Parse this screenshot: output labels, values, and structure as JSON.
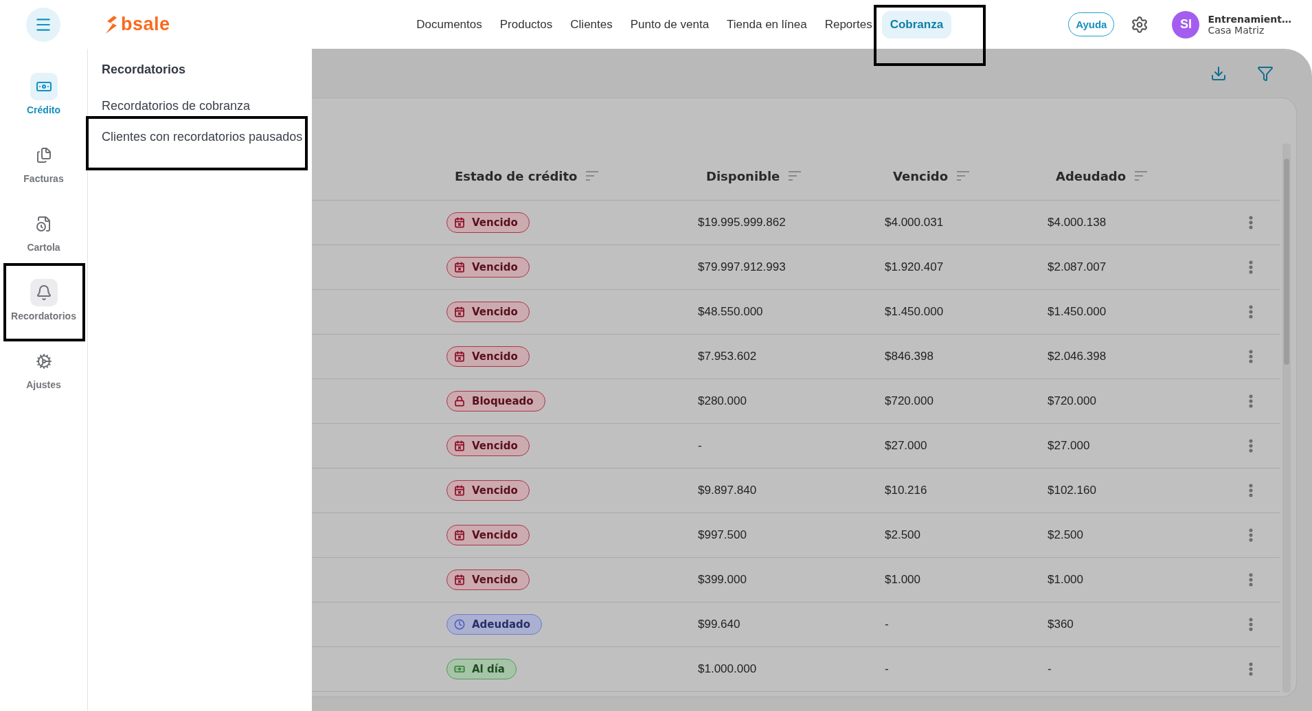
{
  "top_bar": {
    "logo": "bsale",
    "nav": [
      {
        "label": "Documentos",
        "selected": false,
        "highlighted": false
      },
      {
        "label": "Productos",
        "selected": false,
        "highlighted": false
      },
      {
        "label": "Clientes",
        "selected": false,
        "highlighted": false
      },
      {
        "label": "Punto de venta",
        "selected": false,
        "highlighted": false
      },
      {
        "label": "Tienda en línea",
        "selected": false,
        "highlighted": false
      },
      {
        "label": "Reportes",
        "selected": false,
        "highlighted": false
      },
      {
        "label": "Cobranza",
        "selected": true,
        "highlighted": true
      }
    ],
    "help_button": "Ayuda",
    "user": {
      "initials": "SI",
      "name": "Entrenamient…",
      "branch": "Casa Matriz"
    }
  },
  "sidebar": [
    {
      "kind": "credit",
      "label": "Crédito",
      "selected": true,
      "expanded": false,
      "highlighted": false
    },
    {
      "kind": "invoices",
      "label": "Facturas",
      "selected": false,
      "expanded": false,
      "highlighted": false
    },
    {
      "kind": "statement",
      "label": "Cartola",
      "selected": false,
      "expanded": false,
      "highlighted": false
    },
    {
      "kind": "reminders",
      "label": "Recordatorios",
      "selected": false,
      "expanded": true,
      "highlighted": true
    },
    {
      "kind": "settings",
      "label": "Ajustes",
      "selected": false,
      "expanded": false,
      "highlighted": false
    }
  ],
  "flyout": {
    "title": "Recordatorios",
    "items": [
      {
        "label": "Recordatorios de cobranza",
        "highlighted": false
      },
      {
        "label": "Clientes con recordatorios pausados",
        "highlighted": true
      }
    ]
  },
  "table": {
    "columns": [
      "Estado de crédito",
      "Disponible",
      "Vencido",
      "Adeudado"
    ],
    "rows": [
      {
        "status": {
          "kind": "overdue",
          "label": "Vencido"
        },
        "available": "$19.995.999.862",
        "overdue": "$4.000.031",
        "owed": "$4.000.138"
      },
      {
        "status": {
          "kind": "overdue",
          "label": "Vencido"
        },
        "available": "$79.997.912.993",
        "overdue": "$1.920.407",
        "owed": "$2.087.007"
      },
      {
        "status": {
          "kind": "overdue",
          "label": "Vencido"
        },
        "available": "$48.550.000",
        "overdue": "$1.450.000",
        "owed": "$1.450.000"
      },
      {
        "status": {
          "kind": "overdue",
          "label": "Vencido"
        },
        "available": "$7.953.602",
        "overdue": "$846.398",
        "owed": "$2.046.398"
      },
      {
        "status": {
          "kind": "blocked",
          "label": "Bloqueado"
        },
        "available": "$280.000",
        "overdue": "$720.000",
        "owed": "$720.000"
      },
      {
        "status": {
          "kind": "overdue",
          "label": "Vencido"
        },
        "available": "-",
        "overdue": "$27.000",
        "owed": "$27.000"
      },
      {
        "status": {
          "kind": "overdue",
          "label": "Vencido"
        },
        "available": "$9.897.840",
        "overdue": "$10.216",
        "owed": "$102.160"
      },
      {
        "status": {
          "kind": "overdue",
          "label": "Vencido"
        },
        "available": "$997.500",
        "overdue": "$2.500",
        "owed": "$2.500"
      },
      {
        "status": {
          "kind": "overdue",
          "label": "Vencido"
        },
        "available": "$399.000",
        "overdue": "$1.000",
        "owed": "$1.000"
      },
      {
        "status": {
          "kind": "owed",
          "label": "Adeudado"
        },
        "available": "$99.640",
        "overdue": "-",
        "owed": "$360"
      },
      {
        "status": {
          "kind": "current",
          "label": "Al día"
        },
        "available": "$1.000.000",
        "overdue": "-",
        "owed": "-"
      }
    ]
  }
}
